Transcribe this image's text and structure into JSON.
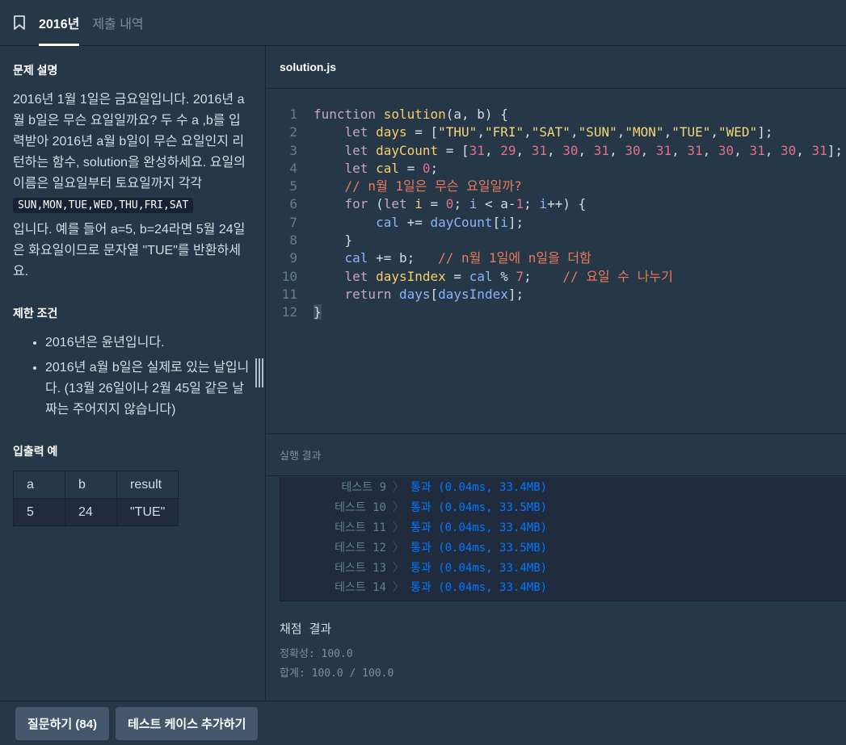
{
  "tabs": [
    {
      "label": "2016년",
      "active": true
    },
    {
      "label": "제출 내역",
      "active": false
    }
  ],
  "problem": {
    "title": "문제 설명",
    "paragraph1": "2016년 1월 1일은 금요일입니다. 2016년 a월 b일은 무슨 요일일까요? 두 수 a ,b를 입력받아 2016년 a월 b일이 무슨 요일인지 리턴하는 함수, solution을 완성하세요. 요일의 이름은 일요일부터 토요일까지 각각",
    "code_chip": "SUN,MON,TUE,WED,THU,FRI,SAT",
    "paragraph2": "입니다. 예를 들어 a=5, b=24라면 5월 24일은 화요일이므로 문자열 \"TUE\"를 반환하세요.",
    "limits_title": "제한 조건",
    "limits": [
      "2016년은 윤년입니다.",
      "2016년 a월 b일은 실제로 있는 날입니다. (13월 26일이나 2월 45일 같은 날짜는 주어지지 않습니다)"
    ],
    "io_title": "입출력 예",
    "io_table": {
      "headers": [
        "a",
        "b",
        "result"
      ],
      "rows": [
        [
          "5",
          "24",
          "\"TUE\""
        ]
      ]
    }
  },
  "editor": {
    "filename": "solution.js",
    "line_numbers": [
      "1",
      "2",
      "3",
      "4",
      "5",
      "6",
      "7",
      "8",
      "9",
      "10",
      "11",
      "12"
    ]
  },
  "result": {
    "header": "실행 결과",
    "tests": [
      {
        "label": "테스트 9",
        "arrow": "〉",
        "result": "통과 (0.04ms, 33.4MB)"
      },
      {
        "label": "테스트 10",
        "arrow": "〉",
        "result": "통과 (0.04ms, 33.5MB)"
      },
      {
        "label": "테스트 11",
        "arrow": "〉",
        "result": "통과 (0.04ms, 33.4MB)"
      },
      {
        "label": "테스트 12",
        "arrow": "〉",
        "result": "통과 (0.04ms, 33.5MB)"
      },
      {
        "label": "테스트 13",
        "arrow": "〉",
        "result": "통과 (0.04ms, 33.4MB)"
      },
      {
        "label": "테스트 14",
        "arrow": "〉",
        "result": "통과 (0.04ms, 33.4MB)"
      }
    ],
    "grading_title": "채점 결과",
    "accuracy": "정확성: 100.0",
    "total": "합계: 100.0 / 100.0"
  },
  "buttons": {
    "question": "질문하기 (84)",
    "add_test": "테스트 케이스 추가하기"
  },
  "icons": {
    "bookmark": "bookmark-icon",
    "drag": "drag-handle-icon"
  },
  "colors": {
    "background": "#263747",
    "pass": "#0078ff",
    "button": "#44576c"
  }
}
